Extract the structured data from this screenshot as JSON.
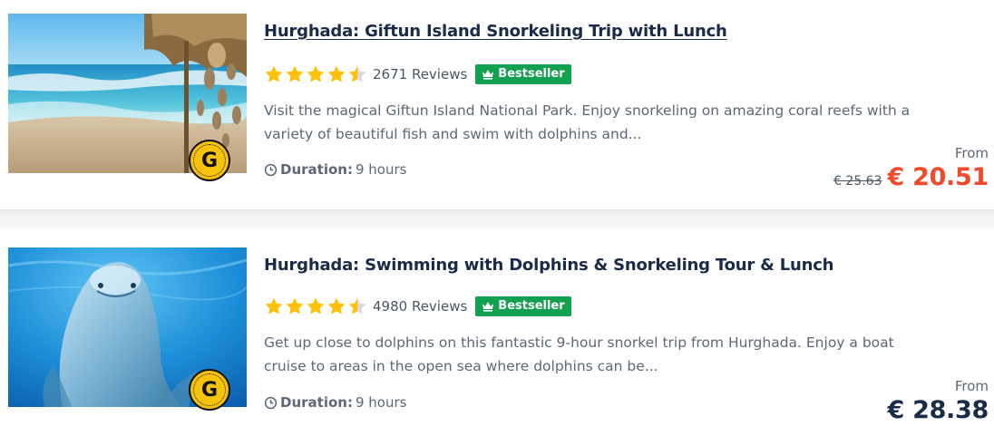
{
  "listings": [
    {
      "title": "Hurghada: Giftun Island Snorkeling Trip with Lunch",
      "rating": 4.5,
      "reviews": "2671 Reviews",
      "badge": "Bestseller",
      "description": "Visit the magical Giftun Island National Park. Enjoy snorkeling on amazing coral reefs with a variety of beautiful fish and swim with dolphins and...",
      "duration_label": "Duration:",
      "duration_value": "9 hours",
      "from_label": "From",
      "old_price": "€ 25.63",
      "price": "€ 20.51",
      "partner_badge": "G"
    },
    {
      "title": "Hurghada: Swimming with Dolphins & Snorkeling Tour & Lunch",
      "rating": 4.5,
      "reviews": "4980 Reviews",
      "badge": "Bestseller",
      "description": "Get up close to dolphins on this fantastic 9-hour snorkel trip from Hurghada. Enjoy a boat cruise to areas in the open sea where dolphins can be...",
      "duration_label": "Duration:",
      "duration_value": "9 hours",
      "from_label": "From",
      "price": "€ 28.38",
      "partner_badge": "G"
    }
  ],
  "colors": {
    "title": "#1a2b49",
    "star": "#ffc107",
    "bestseller": "#12a150",
    "sale_price": "#ef4a2a"
  },
  "icons": {
    "star": "star-icon",
    "crown": "crown-icon",
    "clock": "clock-icon"
  }
}
